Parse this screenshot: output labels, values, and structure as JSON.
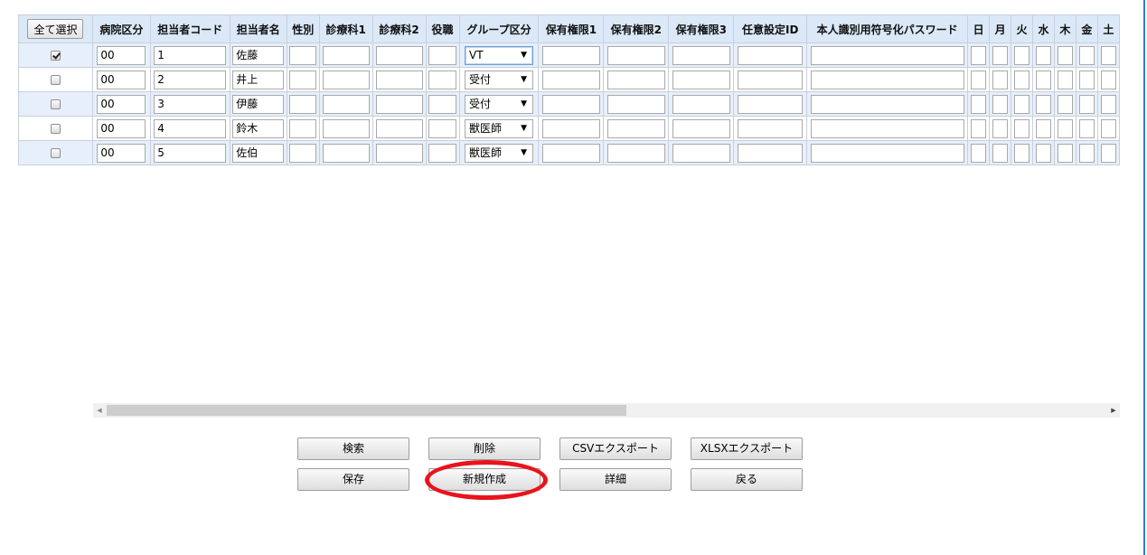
{
  "header": {
    "select_all": "全て選択",
    "columns": [
      "病院区分",
      "担当者コード",
      "担当者名",
      "性別",
      "診療科1",
      "診療科2",
      "役職",
      "グループ区分",
      "保有権限1",
      "保有権限2",
      "保有権限3",
      "任意設定ID",
      "本人識別用符号化パスワード",
      "日",
      "月",
      "火",
      "水",
      "木",
      "金",
      "土"
    ]
  },
  "rows": [
    {
      "checked": true,
      "hospital": "00",
      "code": "1",
      "name": "佐藤",
      "group": "VT"
    },
    {
      "checked": false,
      "hospital": "00",
      "code": "2",
      "name": "井上",
      "group": "受付"
    },
    {
      "checked": false,
      "hospital": "00",
      "code": "3",
      "name": "伊藤",
      "group": "受付"
    },
    {
      "checked": false,
      "hospital": "00",
      "code": "4",
      "name": "鈴木",
      "group": "獣医師"
    },
    {
      "checked": false,
      "hospital": "00",
      "code": "5",
      "name": "佐伯",
      "group": "獣医師"
    }
  ],
  "buttons": {
    "search": "検索",
    "delete": "削除",
    "csv_export": "CSVエクスポート",
    "xlsx_export": "XLSXエクスポート",
    "save": "保存",
    "new": "新規作成",
    "detail": "詳細",
    "back": "戻る"
  },
  "colors": {
    "header_bg": "#dbe8f7",
    "row_alt": "#e6effa",
    "annotation": "#e8141c"
  }
}
